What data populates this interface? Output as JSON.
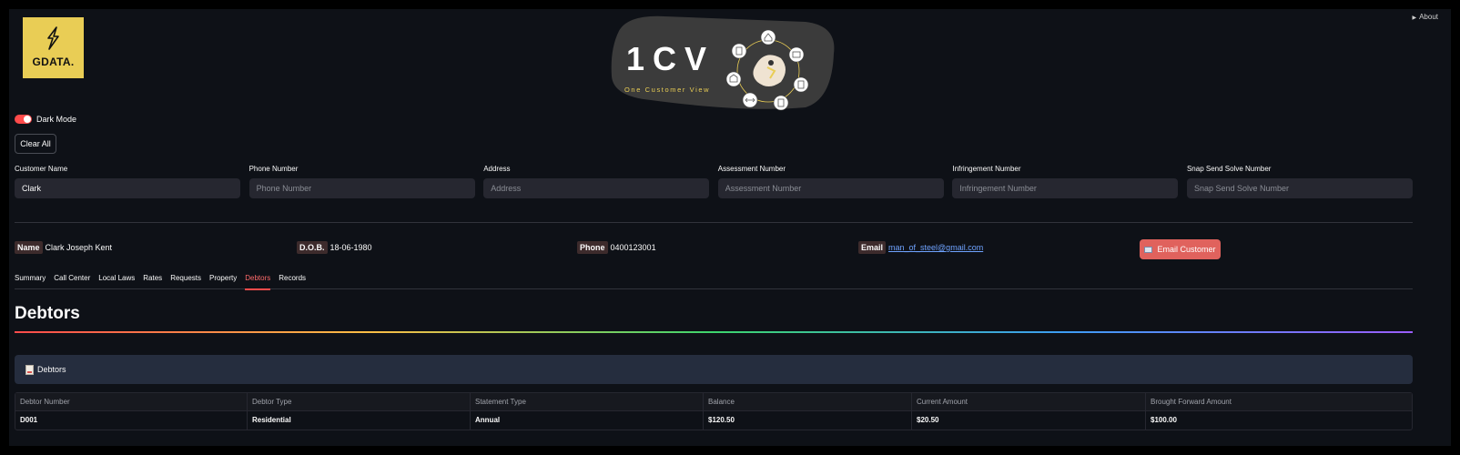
{
  "about": {
    "label": "About"
  },
  "logo": {
    "text": "GDATA."
  },
  "banner": {
    "title": "1CV",
    "tagline": "One Customer View"
  },
  "dark_mode": {
    "label": "Dark Mode",
    "on": true
  },
  "clear_button": {
    "label": "Clear All"
  },
  "search_fields": [
    {
      "label": "Customer Name",
      "value": "Clark",
      "placeholder": ""
    },
    {
      "label": "Phone Number",
      "value": "",
      "placeholder": "Phone Number"
    },
    {
      "label": "Address",
      "value": "",
      "placeholder": "Address"
    },
    {
      "label": "Assessment Number",
      "value": "",
      "placeholder": "Assessment Number"
    },
    {
      "label": "Infringement Number",
      "value": "",
      "placeholder": "Infringement Number"
    },
    {
      "label": "Snap Send Solve Number",
      "value": "",
      "placeholder": "Snap Send Solve Number"
    }
  ],
  "customer": {
    "name_label": "Name",
    "name": "Clark Joseph Kent",
    "dob_label": "D.O.B.",
    "dob": "18-06-1980",
    "phone_label": "Phone",
    "phone": "0400123001",
    "email_label": "Email",
    "email": "man_of_steel@gmail.com",
    "email_button": "Email Customer"
  },
  "tabs": [
    {
      "label": "Summary"
    },
    {
      "label": "Call Center"
    },
    {
      "label": "Local Laws"
    },
    {
      "label": "Rates"
    },
    {
      "label": "Requests"
    },
    {
      "label": "Property"
    },
    {
      "label": "Debtors",
      "active": true
    },
    {
      "label": "Records"
    }
  ],
  "section": {
    "title": "Debtors",
    "box_label": "Debtors"
  },
  "table": {
    "columns": [
      "Debtor Number",
      "Debtor Type",
      "Statement Type",
      "Balance",
      "Current Amount",
      "Brought Forward Amount"
    ],
    "rows": [
      [
        "D001",
        "Residential",
        "Annual",
        "$120.50",
        "$20.50",
        "$100.00"
      ]
    ]
  },
  "colors": {
    "accent": "#ff4b4b",
    "background": "#0e1117",
    "input": "#262730",
    "email_button": "#e0625d",
    "logo_bg": "#e9cd55"
  }
}
